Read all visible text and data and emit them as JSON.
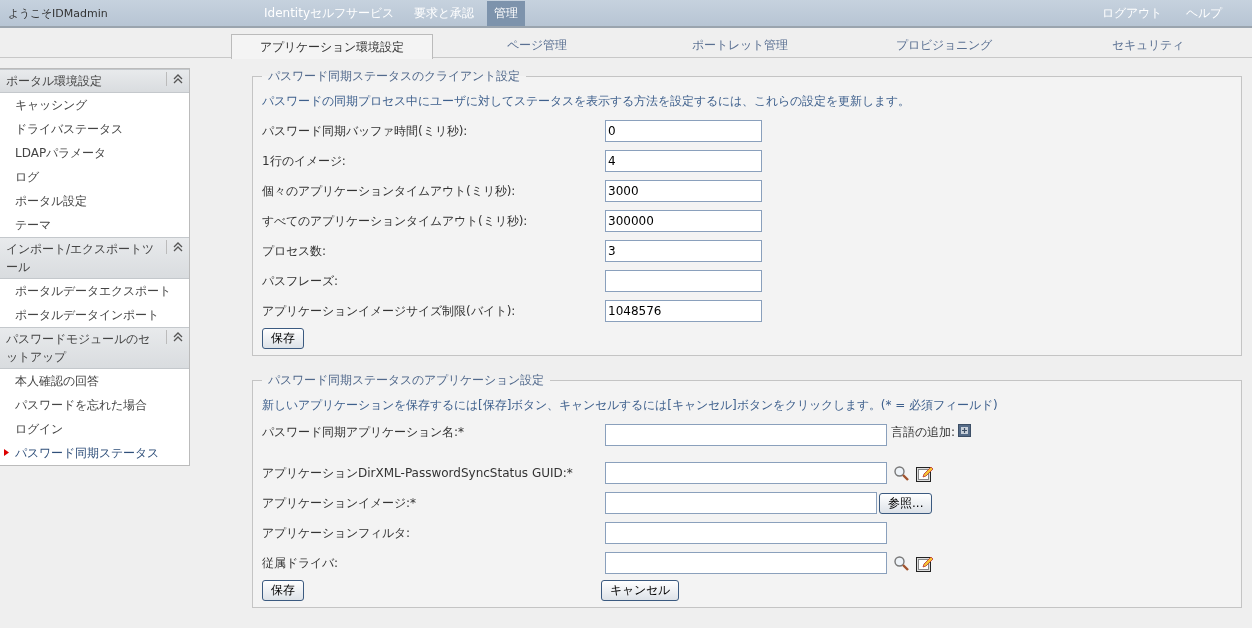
{
  "header": {
    "welcome": "ようこそIDMadmin",
    "nav": [
      {
        "label": "Identityセルフサービス",
        "selected": false
      },
      {
        "label": "要求と承認",
        "selected": false
      },
      {
        "label": "管理",
        "selected": true
      }
    ],
    "links": [
      "ログアウト",
      "ヘルプ"
    ]
  },
  "tabs": [
    {
      "label": "アプリケーション環境設定",
      "selected": true
    },
    {
      "label": "ページ管理",
      "selected": false
    },
    {
      "label": "ポートレット管理",
      "selected": false
    },
    {
      "label": "プロビジョニング",
      "selected": false
    },
    {
      "label": "セキュリティ",
      "selected": false
    }
  ],
  "sidebar": {
    "groups": [
      {
        "title": "ポータル環境設定",
        "items": [
          {
            "label": "キャッシング",
            "selected": false
          },
          {
            "label": "ドライバステータス",
            "selected": false
          },
          {
            "label": "LDAPパラメータ",
            "selected": false
          },
          {
            "label": "ログ",
            "selected": false
          },
          {
            "label": "ポータル設定",
            "selected": false
          },
          {
            "label": "テーマ",
            "selected": false
          }
        ]
      },
      {
        "title": "インポート/エクスポートツール",
        "items": [
          {
            "label": "ポータルデータエクスポート",
            "selected": false
          },
          {
            "label": "ポータルデータインポート",
            "selected": false
          }
        ]
      },
      {
        "title": "パスワードモジュールのセットアップ",
        "items": [
          {
            "label": "本人確認の回答",
            "selected": false
          },
          {
            "label": "パスワードを忘れた場合",
            "selected": false
          },
          {
            "label": "ログイン",
            "selected": false
          },
          {
            "label": "パスワード同期ステータス",
            "selected": true
          }
        ]
      }
    ]
  },
  "client_settings": {
    "legend": "パスワード同期ステータスのクライアント設定",
    "description": "パスワードの同期プロセス中にユーザに対してステータスを表示する方法を設定するには、これらの設定を更新します。",
    "fields": [
      {
        "label": "パスワード同期バッファ時間(ミリ秒):",
        "value": "0"
      },
      {
        "label": "1行のイメージ:",
        "value": "4"
      },
      {
        "label": "個々のアプリケーションタイムアウト(ミリ秒):",
        "value": "3000"
      },
      {
        "label": "すべてのアプリケーションタイムアウト(ミリ秒):",
        "value": "300000"
      },
      {
        "label": "プロセス数:",
        "value": "3"
      },
      {
        "label": "パスフレーズ:"
      },
      {
        "label": "アプリケーションイメージサイズ制限(バイト):",
        "value": "1048576"
      }
    ],
    "save_button": "保存"
  },
  "app_settings": {
    "legend": "パスワード同期ステータスのアプリケーション設定",
    "description": "新しいアプリケーションを保存するには[保存]ボタン、キャンセルするには[キャンセル]ボタンをクリックします。(* = 必須フィールド)",
    "fields": [
      {
        "label": "パスワード同期アプリケーション名:*",
        "kind": "language",
        "extra": "言語の追加:"
      },
      {
        "label": "アプリケーションDirXML-PasswordSyncStatus GUID:*",
        "kind": "lookup"
      },
      {
        "label": "アプリケーションイメージ:*",
        "kind": "browse",
        "extra": "参照..."
      },
      {
        "label": "アプリケーションフィルタ:",
        "kind": "plain"
      },
      {
        "label": "従属ドライバ:",
        "kind": "lookup"
      }
    ],
    "save_button": "保存",
    "cancel_button": "キャンセル"
  }
}
